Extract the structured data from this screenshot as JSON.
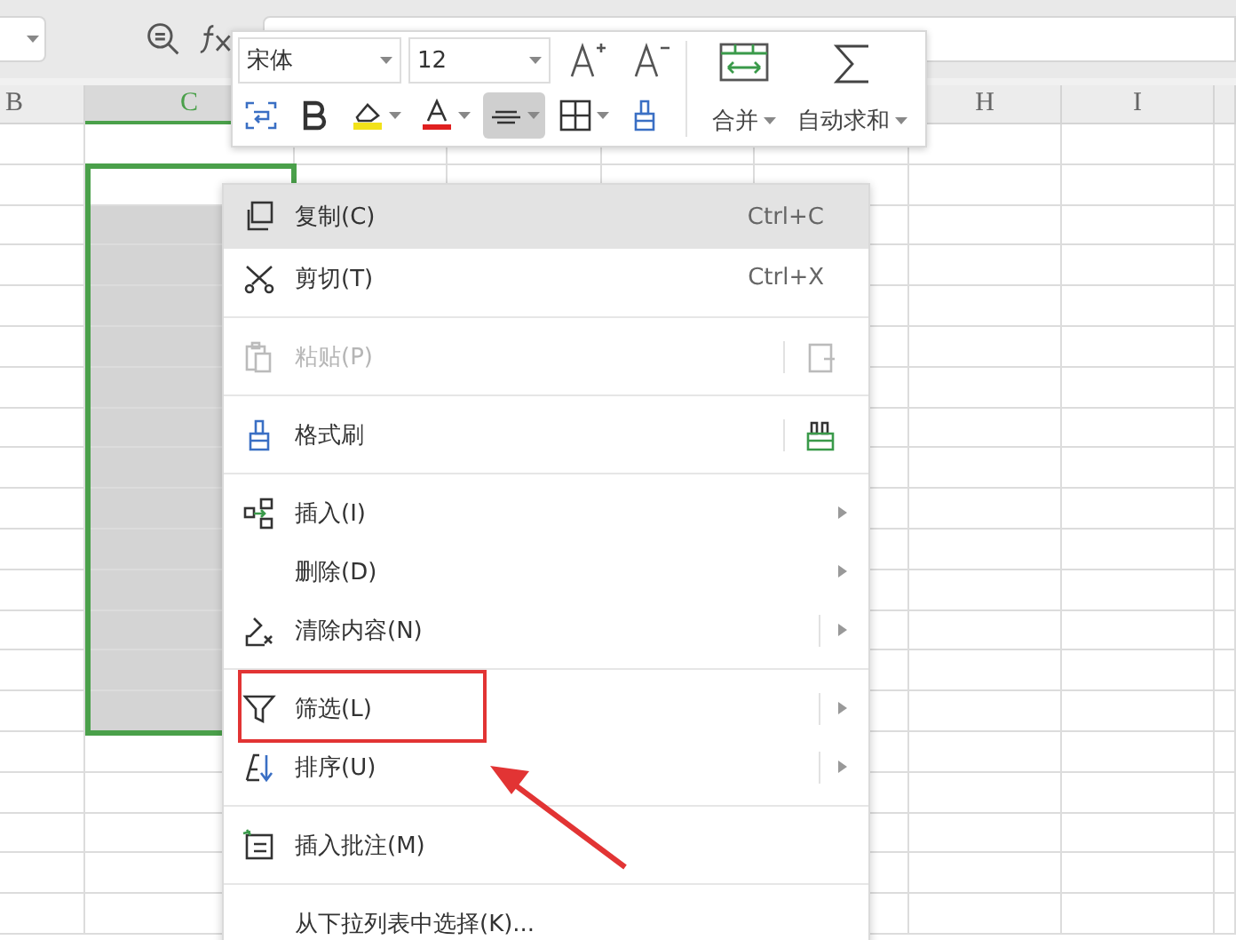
{
  "columns": [
    {
      "label": "B",
      "selected": false
    },
    {
      "label": "C",
      "selected": true
    },
    {
      "label": "H",
      "selected": false
    },
    {
      "label": "I",
      "selected": false
    }
  ],
  "mini_toolbar": {
    "font": "宋体",
    "size": "12",
    "tools": [
      {
        "selected": false
      },
      {
        "selected": false
      },
      {
        "selected": false
      },
      {
        "selected": false
      },
      {
        "selected": true
      },
      {
        "selected": false
      },
      {
        "selected": false
      }
    ],
    "merge": "合并",
    "autosum": "自动求和"
  },
  "context_menu": [
    {
      "kind": "item",
      "label": "复制(C)",
      "shortcut": "Ctrl+C",
      "selected": true,
      "disabled": false
    },
    {
      "kind": "item",
      "label": "剪切(T)",
      "shortcut": "Ctrl+X",
      "selected": false,
      "disabled": false
    },
    {
      "kind": "separator"
    },
    {
      "kind": "item",
      "label": "粘贴(P)",
      "selected": false,
      "disabled": true,
      "split": true
    },
    {
      "kind": "separator"
    },
    {
      "kind": "item",
      "label": "格式刷",
      "selected": false,
      "disabled": false,
      "split": true
    },
    {
      "kind": "separator"
    },
    {
      "kind": "item",
      "label": "插入(I)",
      "selected": false,
      "disabled": false,
      "submenu": true
    },
    {
      "kind": "item",
      "label": "删除(D)",
      "selected": false,
      "disabled": false,
      "submenu": true
    },
    {
      "kind": "item",
      "label": "清除内容(N)",
      "selected": false,
      "disabled": false,
      "submenu": true,
      "split": true
    },
    {
      "kind": "separator"
    },
    {
      "kind": "item",
      "label": "筛选(L)",
      "selected": false,
      "disabled": false,
      "submenu": true,
      "split": true
    },
    {
      "kind": "item",
      "label": "排序(U)",
      "selected": false,
      "disabled": false,
      "submenu": true,
      "split": true
    },
    {
      "kind": "separator"
    },
    {
      "kind": "item",
      "label": "插入批注(M)",
      "selected": false,
      "disabled": false
    },
    {
      "kind": "separator"
    },
    {
      "kind": "item",
      "label": "从下拉列表中选择(K)...",
      "selected": false,
      "disabled": false
    }
  ]
}
